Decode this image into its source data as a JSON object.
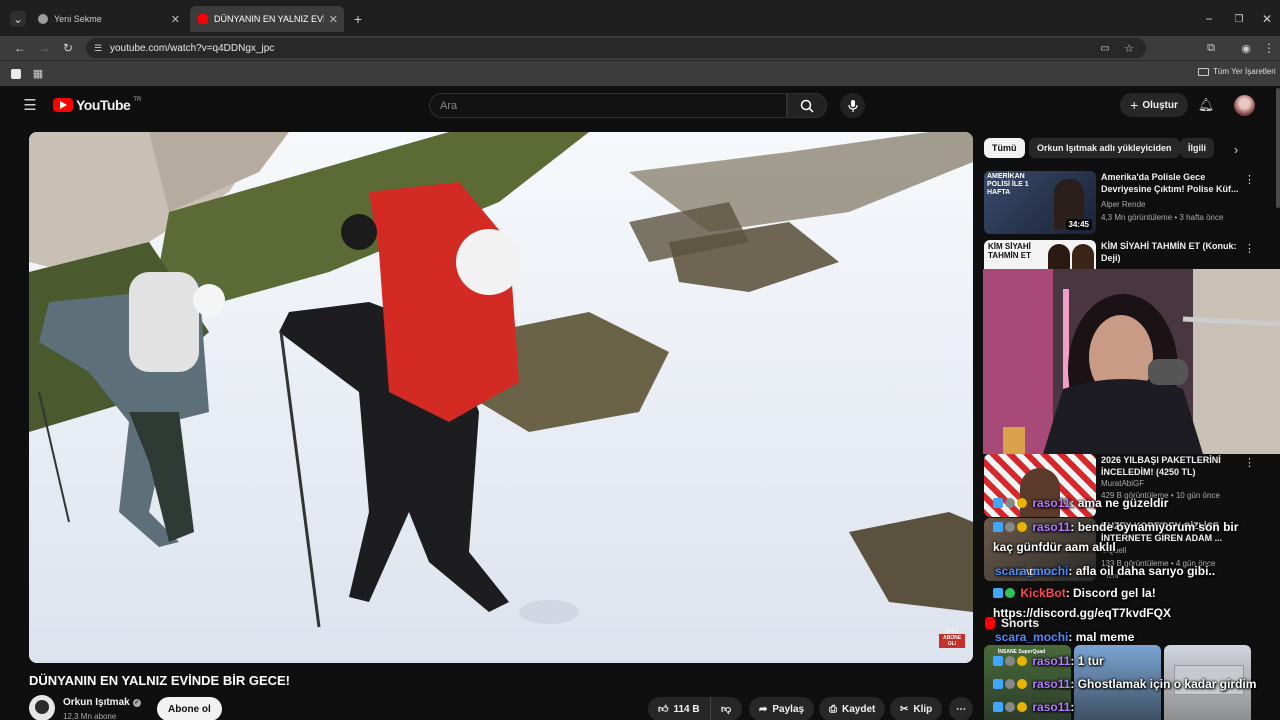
{
  "browser": {
    "tabs": [
      {
        "label": "Yeni Sekme"
      },
      {
        "label": "DÜNYANIN EN YALNIZ EVİNDE"
      }
    ],
    "url": "youtube.com/watch?v=q4DDNgx_jpc",
    "bookmarks_label": "Tüm Yer İşaretleri"
  },
  "youtube": {
    "logo_text": "YouTube",
    "logo_sup": "TR",
    "search_placeholder": "Ara",
    "create_label": "Oluştur",
    "video_overlay_badge": "ABONE OL!",
    "video_title": "DÜNYANIN EN YALNIZ EVİNDE BİR GECE!",
    "channel": {
      "name": "Orkun Işıtmak",
      "subs": "12,3 Mn abone",
      "subscribe_label": "Abone ol"
    },
    "actions": {
      "likes": "114 B",
      "share": "Paylaş",
      "save": "Kaydet",
      "clip": "Klip"
    },
    "chips": [
      "Tümü",
      "Orkun Işıtmak adlı yükleyiciden",
      "İlgili"
    ],
    "recommendations": [
      {
        "title": "Amerika'da Polisle Gece Devriyesine Çıktım! Polise Küf...",
        "channel": "Alper Rende",
        "meta": "4,3 Mn görüntüleme • 3 hafta önce",
        "duration": "34:45",
        "thumb_text": "AMERİKAN POLİSİ İLE 1 HAFTA"
      },
      {
        "title": "KİM SİYAHİ TAHMİN ET (Konuk: Deji)",
        "channel": "",
        "meta": "",
        "duration": "",
        "thumb_text": "KİM SİYAHİ TAHMİN ET"
      },
      {
        "title": "2026 YILBAŞI PAKETLERİNİ İNCELEDİM! (4250 TL)",
        "channel": "MuratAbiGF",
        "meta": "429 B görüntüleme • 10 gün önce",
        "duration": "",
        "thumb_text": ""
      },
      {
        "title": "KUZEY KORE'DEN GİZLİCE İNTERNETE GİREN ADAM ...",
        "channel": "...Quell",
        "meta": "133 B görüntüleme • 4 gün önce",
        "duration": "",
        "thumb_text": "CADU NU"
      }
    ],
    "shorts_label": "Shorts",
    "shorts_thumb_texts": [
      "İNSANE SuperQuad",
      "",
      "",
      ""
    ],
    "short_yeni": "Yeni"
  },
  "chat": [
    {
      "user": "raso11",
      "text": ": ama ne güzeldir",
      "color": "#b47cff"
    },
    {
      "user": "raso11",
      "text": ": bende oynamıyorum son bir",
      "color": "#b47cff"
    },
    {
      "user": "",
      "text": "kaç günfdür aam aklıl",
      "color": ""
    },
    {
      "user": "scara_mochi",
      "text": ": afla oil daha sarıyo gibi..",
      "color": "#4f8cff"
    },
    {
      "user": "KickBot",
      "text": ": Discord gel la!",
      "color": "#ff4b4b"
    },
    {
      "user": "",
      "text": "https://discord.gg/eqT7kvdFQX",
      "color": ""
    },
    {
      "user": "scara_mochi",
      "text": ": mal meme",
      "color": "#4f8cff"
    },
    {
      "user": "raso11",
      "text": ": 1 tur",
      "color": "#b47cff"
    },
    {
      "user": "raso11",
      "text": ": Ghostlamak için o kadar girdim",
      "color": "#b47cff"
    },
    {
      "user": "raso11",
      "text": ":",
      "color": "#b47cff"
    }
  ],
  "colors": {
    "yt_red": "#ff0000",
    "chip_active": "#f1f1f1",
    "chip_bg": "#272727",
    "bg": "#0f0f0f"
  }
}
